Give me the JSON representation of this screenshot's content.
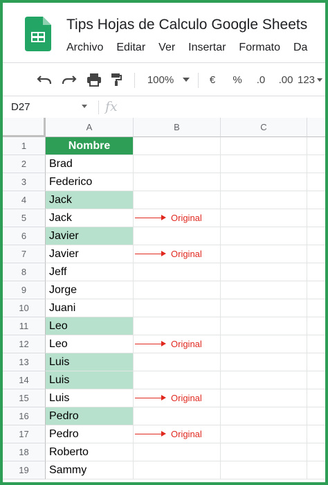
{
  "app": {
    "title": "Tips Hojas de Calculo Google Sheets",
    "menu": [
      "Archivo",
      "Editar",
      "Ver",
      "Insertar",
      "Formato",
      "Da"
    ]
  },
  "toolbar": {
    "zoom": "100%",
    "currency": "€",
    "percent": "%",
    "decrease_decimals": ".0",
    "increase_decimals": ".00",
    "more_formats": "123"
  },
  "formula_bar": {
    "name_box": "D27",
    "fx_label": "fx"
  },
  "columns": [
    "A",
    "B",
    "C"
  ],
  "rows": [
    {
      "num": "1",
      "a": "Nombre",
      "header": true,
      "highlight": false,
      "note": ""
    },
    {
      "num": "2",
      "a": "Brad",
      "highlight": false,
      "note": ""
    },
    {
      "num": "3",
      "a": "Federico",
      "highlight": false,
      "note": ""
    },
    {
      "num": "4",
      "a": "Jack",
      "highlight": true,
      "note": ""
    },
    {
      "num": "5",
      "a": "Jack",
      "highlight": false,
      "note": "Original"
    },
    {
      "num": "6",
      "a": "Javier",
      "highlight": true,
      "note": ""
    },
    {
      "num": "7",
      "a": "Javier",
      "highlight": false,
      "note": "Original"
    },
    {
      "num": "8",
      "a": "Jeff",
      "highlight": false,
      "note": ""
    },
    {
      "num": "9",
      "a": "Jorge",
      "highlight": false,
      "note": ""
    },
    {
      "num": "10",
      "a": "Juani",
      "highlight": false,
      "note": ""
    },
    {
      "num": "11",
      "a": "Leo",
      "highlight": true,
      "note": ""
    },
    {
      "num": "12",
      "a": "Leo",
      "highlight": false,
      "note": "Original"
    },
    {
      "num": "13",
      "a": "Luis",
      "highlight": true,
      "note": ""
    },
    {
      "num": "14",
      "a": "Luis",
      "highlight": true,
      "note": ""
    },
    {
      "num": "15",
      "a": "Luis",
      "highlight": false,
      "note": "Original"
    },
    {
      "num": "16",
      "a": "Pedro",
      "highlight": true,
      "note": ""
    },
    {
      "num": "17",
      "a": "Pedro",
      "highlight": false,
      "note": "Original"
    },
    {
      "num": "18",
      "a": "Roberto",
      "highlight": false,
      "note": ""
    },
    {
      "num": "19",
      "a": "Sammy",
      "highlight": false,
      "note": ""
    }
  ],
  "colors": {
    "accent_green": "#2e9e57",
    "highlight": "#b7e1cd",
    "annotation_red": "#e0281f"
  },
  "icons": [
    "sheets-logo-icon",
    "undo-icon",
    "redo-icon",
    "print-icon",
    "paint-format-icon",
    "dropdown-caret-icon",
    "fx-icon"
  ]
}
